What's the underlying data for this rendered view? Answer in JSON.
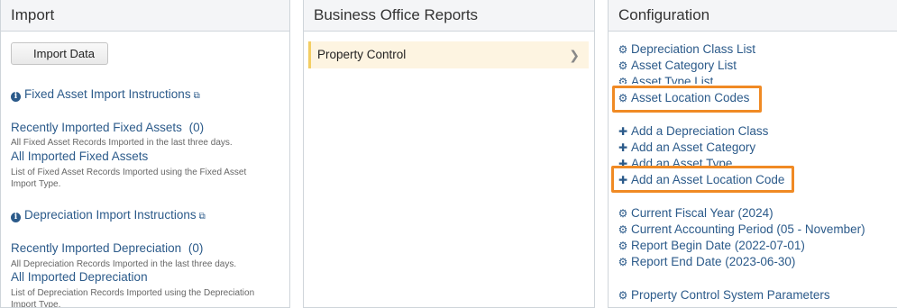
{
  "import": {
    "title": "Import",
    "import_button": "Import Data",
    "fixed_asset_instructions": "Fixed Asset Import Instructions",
    "recent_fixed_assets": "Recently Imported Fixed Assets",
    "recent_fixed_assets_count": "(0)",
    "recent_fixed_assets_desc": "All Fixed Asset Records Imported in the last three days.",
    "all_fixed_assets": "All Imported Fixed Assets",
    "all_fixed_assets_desc": "List of Fixed Asset Records Imported using the Fixed Asset Import Type.",
    "depreciation_instructions": "Depreciation Import Instructions",
    "recent_depreciation": "Recently Imported Depreciation",
    "recent_depreciation_count": "(0)",
    "recent_depreciation_desc": "All Depreciation Records Imported in the last three days.",
    "all_depreciation": "All Imported Depreciation",
    "all_depreciation_desc": "List of Depreciation Records Imported using the Depreciation Import Type."
  },
  "reports": {
    "title": "Business Office Reports",
    "items": [
      {
        "label": "Property Control"
      }
    ]
  },
  "config": {
    "title": "Configuration",
    "lists": [
      "Depreciation Class List",
      "Asset Category List",
      "Asset Type List",
      "Asset Location Codes"
    ],
    "adds": [
      "Add a Depreciation Class",
      "Add an Asset Category",
      "Add an Asset Type",
      "Add an Asset Location Code"
    ],
    "settings": [
      "Current Fiscal Year (2024)",
      "Current Accounting Period (05 - November)",
      "Report Begin Date (2022-07-01)",
      "Report End Date (2023-06-30)"
    ],
    "params": "Property Control System Parameters"
  },
  "colors": {
    "highlight": "#f08a24",
    "link": "#2b5a8a"
  }
}
